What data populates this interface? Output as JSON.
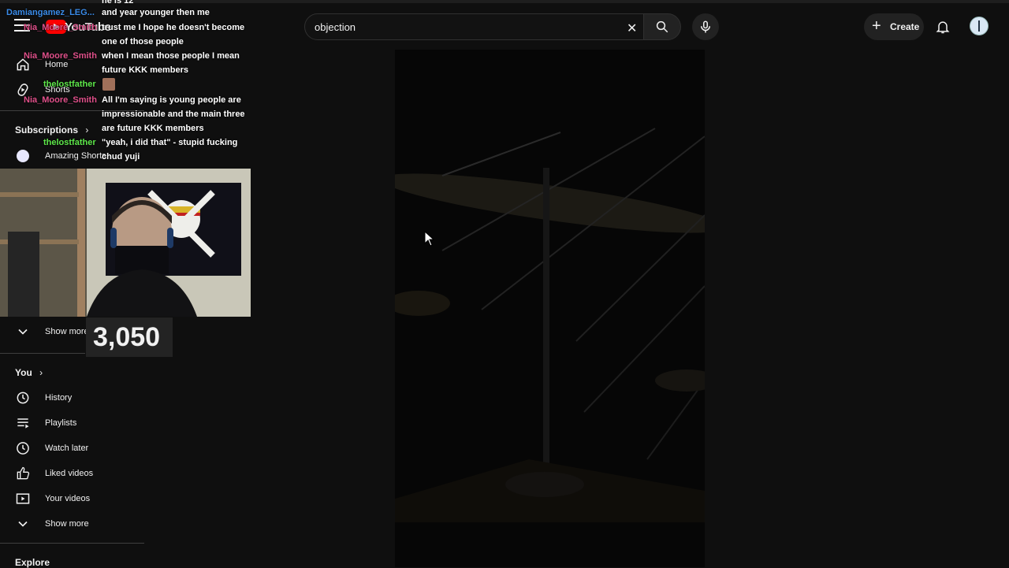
{
  "brand": {
    "logo_text": "YouTube"
  },
  "search": {
    "value": "objection"
  },
  "header": {
    "create_label": "Create"
  },
  "sidebar": {
    "top_items": [
      {
        "label": "Home",
        "icon": "home-icon"
      },
      {
        "label": "Shorts",
        "icon": "shorts-icon"
      }
    ],
    "subscriptions_title": "Subscriptions",
    "subscriptions": [
      {
        "label": "Amazing Shorts"
      }
    ],
    "show_more_top": "Show more",
    "you_title": "You",
    "you_items": [
      {
        "label": "History",
        "icon": "history-icon"
      },
      {
        "label": "Playlists",
        "icon": "playlists-icon"
      },
      {
        "label": "Watch later",
        "icon": "watch-later-icon"
      },
      {
        "label": "Liked videos",
        "icon": "liked-videos-icon"
      },
      {
        "label": "Your videos",
        "icon": "your-videos-icon"
      },
      {
        "label": "Show more",
        "icon": "chevron-down-icon"
      }
    ],
    "explore_title": "Explore"
  },
  "chat": {
    "messages": [
      {
        "user": "",
        "text": "he is 12"
      },
      {
        "user": "Damiangamez_LEG...",
        "text": "and year younger then me",
        "color": "#3a8be8"
      },
      {
        "user": "Nia_Moore_Smith",
        "text": "trust me I hope he doesn't become one of those people",
        "color": "#e0508a"
      },
      {
        "user": "Nia_Moore_Smith",
        "text": "when I mean those people I mean future KKK members",
        "color": "#e0508a"
      },
      {
        "user": "thelostfather",
        "text": "",
        "color": "#5ee84a"
      },
      {
        "user": "Nia_Moore_Smith",
        "text": "All I'm saying is young people are impressionable and the main three are future KKK members",
        "color": "#e0508a"
      },
      {
        "user": "thelostfather",
        "text": "\"yeah, i did that\" - stupid fucking chud yuji",
        "color": "#5ee84a"
      }
    ]
  },
  "counter": {
    "value": "3,050"
  },
  "colors": {
    "background": "#0f0f0f",
    "accent": "#ff0000"
  }
}
